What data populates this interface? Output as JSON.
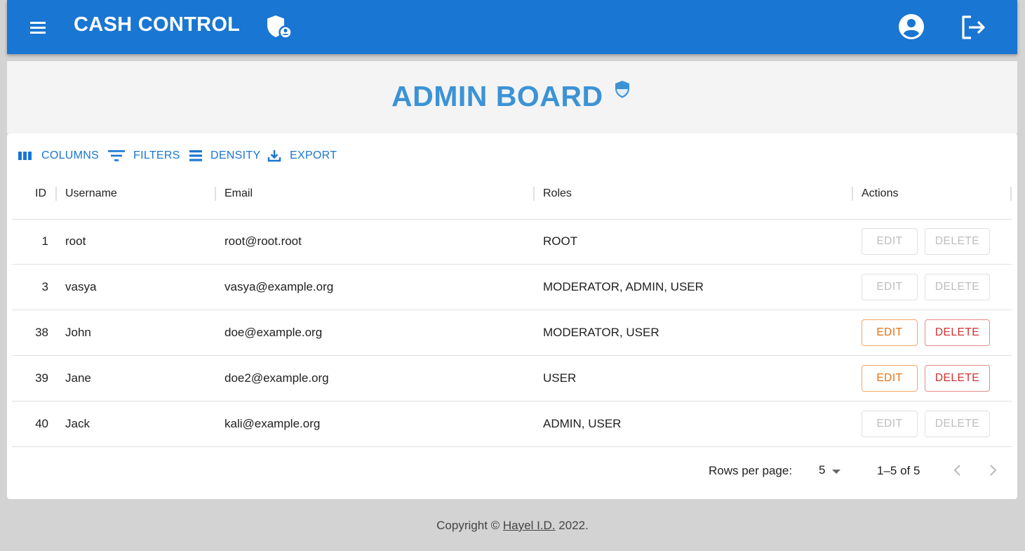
{
  "appbar": {
    "title": "CASH CONTROL",
    "brand_color": "#1976d2",
    "icons": [
      "menu-icon",
      "shield-account-icon",
      "account-circle-icon",
      "logout-icon"
    ]
  },
  "board": {
    "title": "ADMIN BOARD",
    "title_color": "#3b93d6",
    "icon": "shield-icon"
  },
  "toolbar": {
    "columns": "COLUMNS",
    "filters": "FILTERS",
    "density": "DENSITY",
    "export": "EXPORT"
  },
  "table": {
    "headers": {
      "id": "ID",
      "username": "Username",
      "email": "Email",
      "roles": "Roles",
      "actions": "Actions"
    },
    "edit_label": "EDIT",
    "delete_label": "DELETE",
    "rows": [
      {
        "id": "1",
        "username": "root",
        "email": "root@root.root",
        "roles": "ROOT",
        "actions_enabled": false
      },
      {
        "id": "3",
        "username": "vasya",
        "email": "vasya@example.org",
        "roles": "MODERATOR, ADMIN, USER",
        "actions_enabled": false
      },
      {
        "id": "38",
        "username": "John",
        "email": "doe@example.org",
        "roles": "MODERATOR, USER",
        "actions_enabled": true
      },
      {
        "id": "39",
        "username": "Jane",
        "email": "doe2@example.org",
        "roles": "USER",
        "actions_enabled": true
      },
      {
        "id": "40",
        "username": "Jack",
        "email": "kali@example.org",
        "roles": "ADMIN, USER",
        "actions_enabled": false
      }
    ]
  },
  "pagination": {
    "rows_per_page_label": "Rows per page:",
    "rows_per_page": "5",
    "range": "1–5 of 5"
  },
  "footer": {
    "prefix": "Copyright ©",
    "author": "Hayel I.D.",
    "suffix": "2022."
  }
}
